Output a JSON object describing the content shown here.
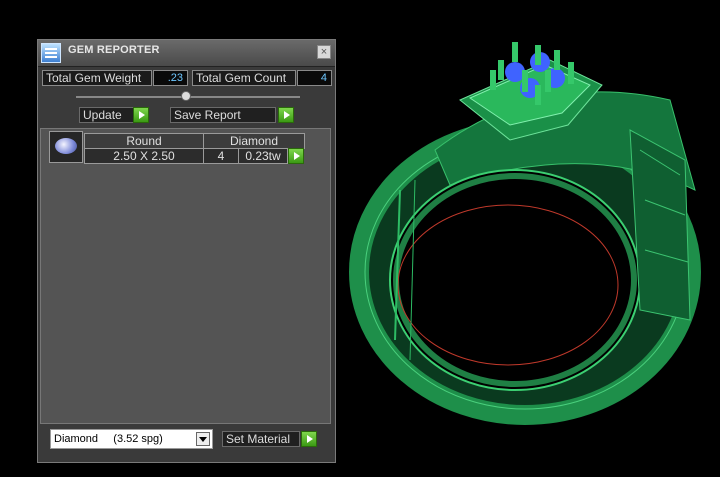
{
  "panel": {
    "title": "GEM REPORTER",
    "close_symbol": "×",
    "total_gem_weight_label": "Total Gem Weight",
    "total_gem_weight_value": ".23",
    "total_gem_count_label": "Total Gem Count",
    "total_gem_count_value": "4",
    "update_label": "Update",
    "save_report_label": "Save Report",
    "table": {
      "headers": [
        "Round",
        "Diamond"
      ],
      "row": {
        "size": "2.50 X 2.50",
        "count": "4",
        "weight": "0.23tw"
      }
    },
    "material_select": {
      "value": "Diamond     (3.52 spg)"
    },
    "set_material_label": "Set Material"
  },
  "colors": {
    "accent_green": "#4cb826",
    "ring_green": "#1c8a4a",
    "value_blue": "#6ec7ff"
  },
  "icons": [
    "gem-reporter-app-icon",
    "close-icon",
    "arrow-right-icon",
    "round-gem-icon",
    "chevron-down-icon"
  ]
}
